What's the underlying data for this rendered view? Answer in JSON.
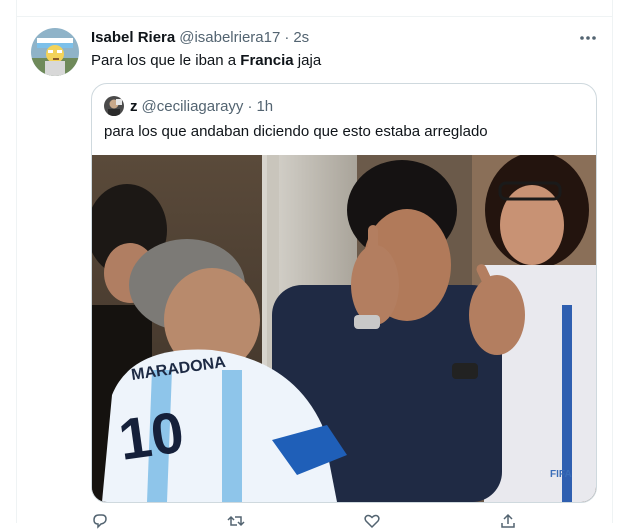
{
  "tweet": {
    "author_name": "Isabel Riera",
    "author_handle": "@isabelriera17",
    "separator": "·",
    "time": "2s",
    "text_before": "Para los que le iban a ",
    "text_bold": "Francia",
    "text_after": " jaja"
  },
  "quoted": {
    "author_name": "z",
    "author_handle": "@ceciliagarayy",
    "separator": "·",
    "time": "1h",
    "text": "para los que andaban diciendo que esto estaba arreglado"
  },
  "media_text": {
    "jersey": "MARADONA",
    "number": "10",
    "watermark": "FIFA"
  },
  "icons": {
    "more": "more-dots-icon",
    "reply": "reply-icon",
    "retweet": "retweet-icon",
    "like": "heart-icon",
    "share": "share-icon"
  },
  "colors": {
    "text": "#0f1419",
    "secondary": "#536471",
    "border": "#cfd9de",
    "divider": "#eff3f4"
  }
}
